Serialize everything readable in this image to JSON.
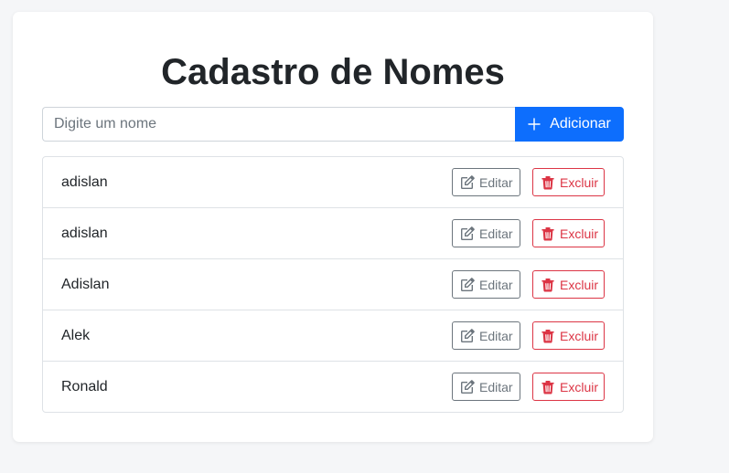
{
  "app": {
    "title": "Cadastro de Nomes"
  },
  "form": {
    "input_placeholder": "Digite um nome",
    "input_value": "",
    "add_label": "Adicionar",
    "add_icon": "plus-icon"
  },
  "list": {
    "items": [
      {
        "name": "adislan",
        "edit_label": "Editar",
        "delete_label": "Excluir"
      },
      {
        "name": "adislan",
        "edit_label": "Editar",
        "delete_label": "Excluir"
      },
      {
        "name": "Adislan",
        "edit_label": "Editar",
        "delete_label": "Excluir"
      },
      {
        "name": "Alek",
        "edit_label": "Editar",
        "delete_label": "Excluir"
      },
      {
        "name": "Ronald",
        "edit_label": "Editar",
        "delete_label": "Excluir"
      }
    ],
    "edit_icon": "pencil-square-icon",
    "delete_icon": "trash-icon"
  },
  "colors": {
    "primary": "#0d6efd",
    "secondary": "#6c757d",
    "danger": "#dc3545",
    "background": "#f5f6f8"
  }
}
